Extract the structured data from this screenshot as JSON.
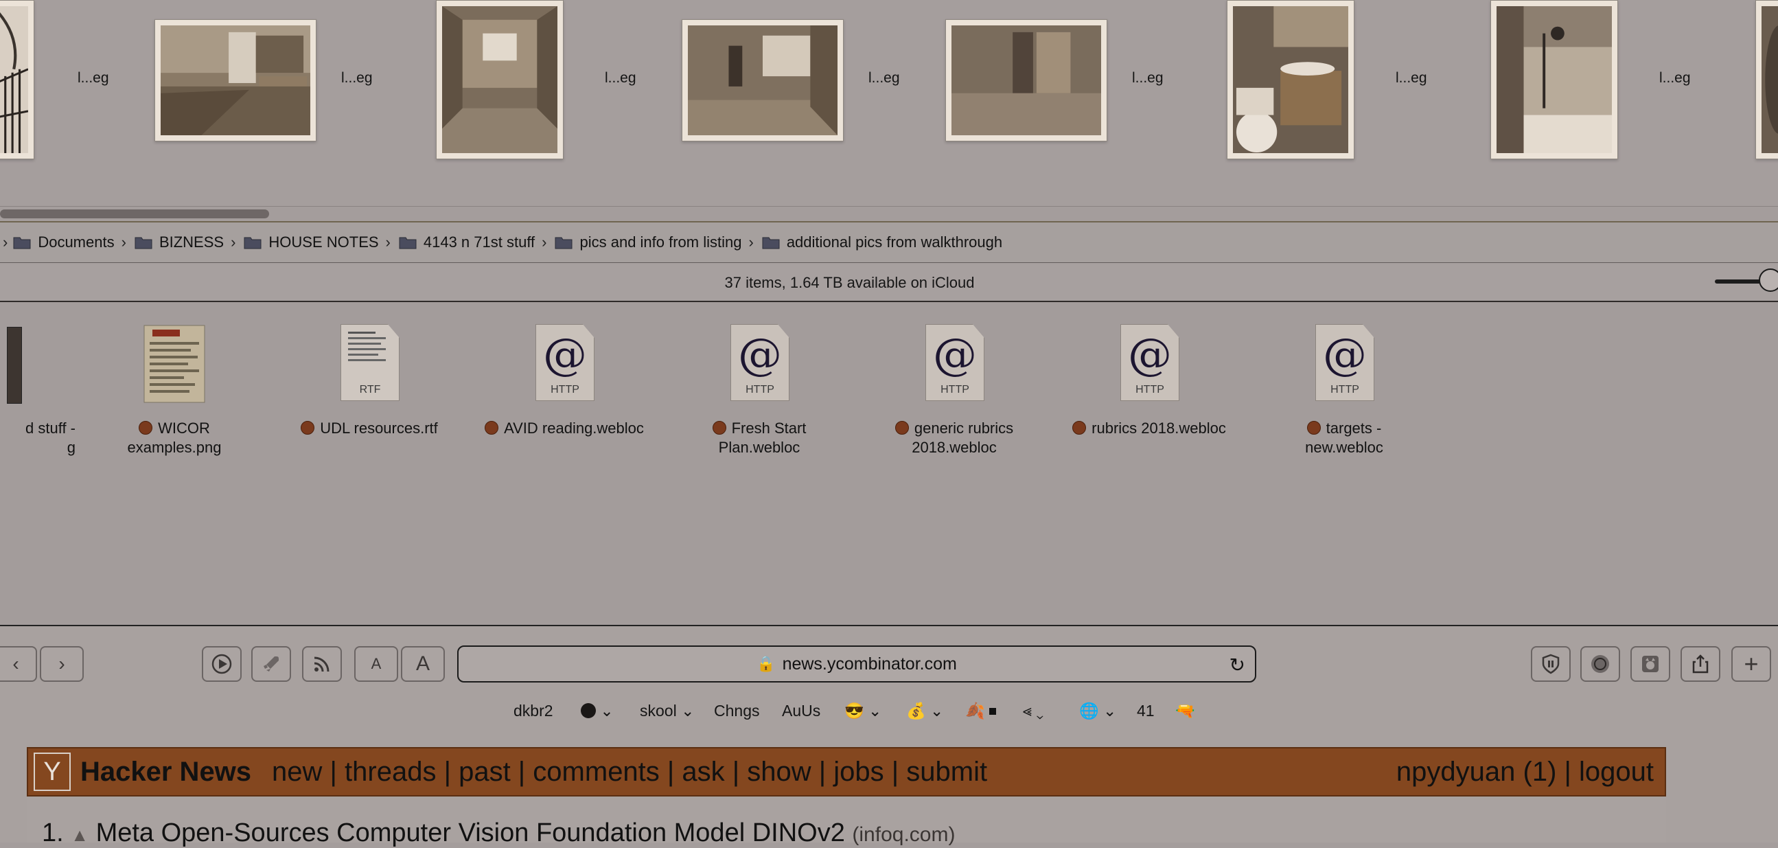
{
  "gallery": {
    "labels": [
      "l...eg",
      "l...eg",
      "l...eg",
      "l...eg",
      "l...eg",
      "l...eg",
      "l...eg"
    ]
  },
  "path": [
    {
      "label": "Documents"
    },
    {
      "label": "BIZNESS"
    },
    {
      "label": "HOUSE NOTES"
    },
    {
      "label": "4143 n 71st stuff"
    },
    {
      "label": "pics and info from listing"
    },
    {
      "label": "additional pics from walkthrough"
    }
  ],
  "status": {
    "text": "37 items, 1.64 TB available on iCloud"
  },
  "files": [
    {
      "name_line1": "d stuff -",
      "name_line2": "g",
      "kind": "",
      "tag": false
    },
    {
      "name_line1": "WICOR",
      "name_line2": "examples.png",
      "kind": "",
      "tag": true
    },
    {
      "name_line1": "UDL resources.rtf",
      "name_line2": "",
      "kind": "RTF",
      "tag": true
    },
    {
      "name_line1": "AVID reading.webloc",
      "name_line2": "",
      "kind": "HTTP",
      "tag": true
    },
    {
      "name_line1": "Fresh Start",
      "name_line2": "Plan.webloc",
      "kind": "HTTP",
      "tag": true
    },
    {
      "name_line1": "generic rubrics",
      "name_line2": "2018.webloc",
      "kind": "HTTP",
      "tag": true
    },
    {
      "name_line1": "rubrics 2018.webloc",
      "name_line2": "",
      "kind": "HTTP",
      "tag": true
    },
    {
      "name_line1": "targets -",
      "name_line2": "new.webloc",
      "kind": "HTTP",
      "tag": true
    }
  ],
  "browser": {
    "url": "news.ycombinator.com",
    "font_small": "A",
    "font_large": "A",
    "bookmarks": [
      "dkbr2",
      "skool",
      "Chngs",
      "AuUs",
      "41"
    ]
  },
  "hn": {
    "logo": "Y",
    "title": "Hacker News",
    "nav": "new | threads | past | comments | ask | show | jobs | submit",
    "user": "npydyuan (1) | logout",
    "story_rank": "1.",
    "story_title": "Meta Open-Sources Computer Vision Foundation Model DINOv2",
    "story_site": "(infoq.com)"
  },
  "colors": {
    "hn_orange": "#84471f",
    "tag_red": "#7a3a1d"
  }
}
